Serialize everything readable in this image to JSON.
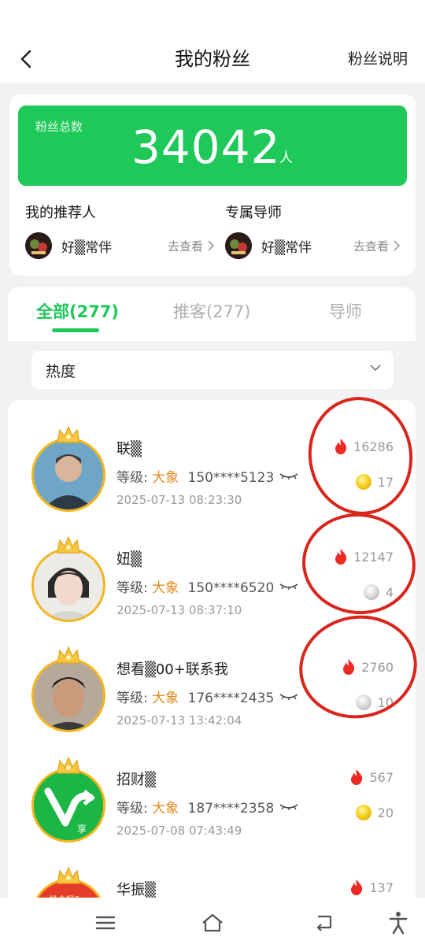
{
  "header": {
    "title": "我的粉丝",
    "right_link": "粉丝说明",
    "back_icon": "chevron-left-icon"
  },
  "summary": {
    "total_label": "粉丝总数",
    "total_value": "34042",
    "total_unit": "人",
    "accent_color": "#1ec95a",
    "referrer": {
      "title": "我的推荐人",
      "name": "好▒常伴",
      "link": "去查看"
    },
    "mentor": {
      "title": "专属导师",
      "name": "好▒常伴",
      "link": "去查看"
    }
  },
  "tabs": [
    {
      "label": "全部(277)",
      "active": true
    },
    {
      "label": "推客(277)",
      "active": false
    },
    {
      "label": "导师",
      "active": false
    }
  ],
  "sort": {
    "selected": "热度"
  },
  "fans": [
    {
      "name": "联▒",
      "level_label": "等级:",
      "level": "大象",
      "phone": "150****5123",
      "time": "2025-07-13 08:23:30",
      "heat": "16286",
      "coins": "17",
      "coin_type": "gold"
    },
    {
      "name": "妞▒",
      "level_label": "等级:",
      "level": "大象",
      "phone": "150****6520",
      "time": "2025-07-13 08:37:10",
      "heat": "12147",
      "coins": "4",
      "coin_type": "silver"
    },
    {
      "name": "想看▒00+联系我",
      "level_label": "等级:",
      "level": "大象",
      "phone": "176****2435",
      "time": "2025-07-13 13:42:04",
      "heat": "2760",
      "coins": "10",
      "coin_type": "silver"
    },
    {
      "name": "招财▒",
      "level_label": "等级:",
      "level": "大象",
      "phone": "187****2358",
      "time": "2025-07-08 07:43:49",
      "heat": "567",
      "coins": "20",
      "coin_type": "gold",
      "avatar_text": "享"
    },
    {
      "name": "华振▒",
      "level_label": "",
      "level": "",
      "phone": "",
      "time": "",
      "heat": "137",
      "coins": "",
      "coin_type": "",
      "badge_text": "机会吗?"
    }
  ],
  "nav": [
    "menu-icon",
    "home-icon",
    "back-icon",
    "accessibility-icon"
  ]
}
